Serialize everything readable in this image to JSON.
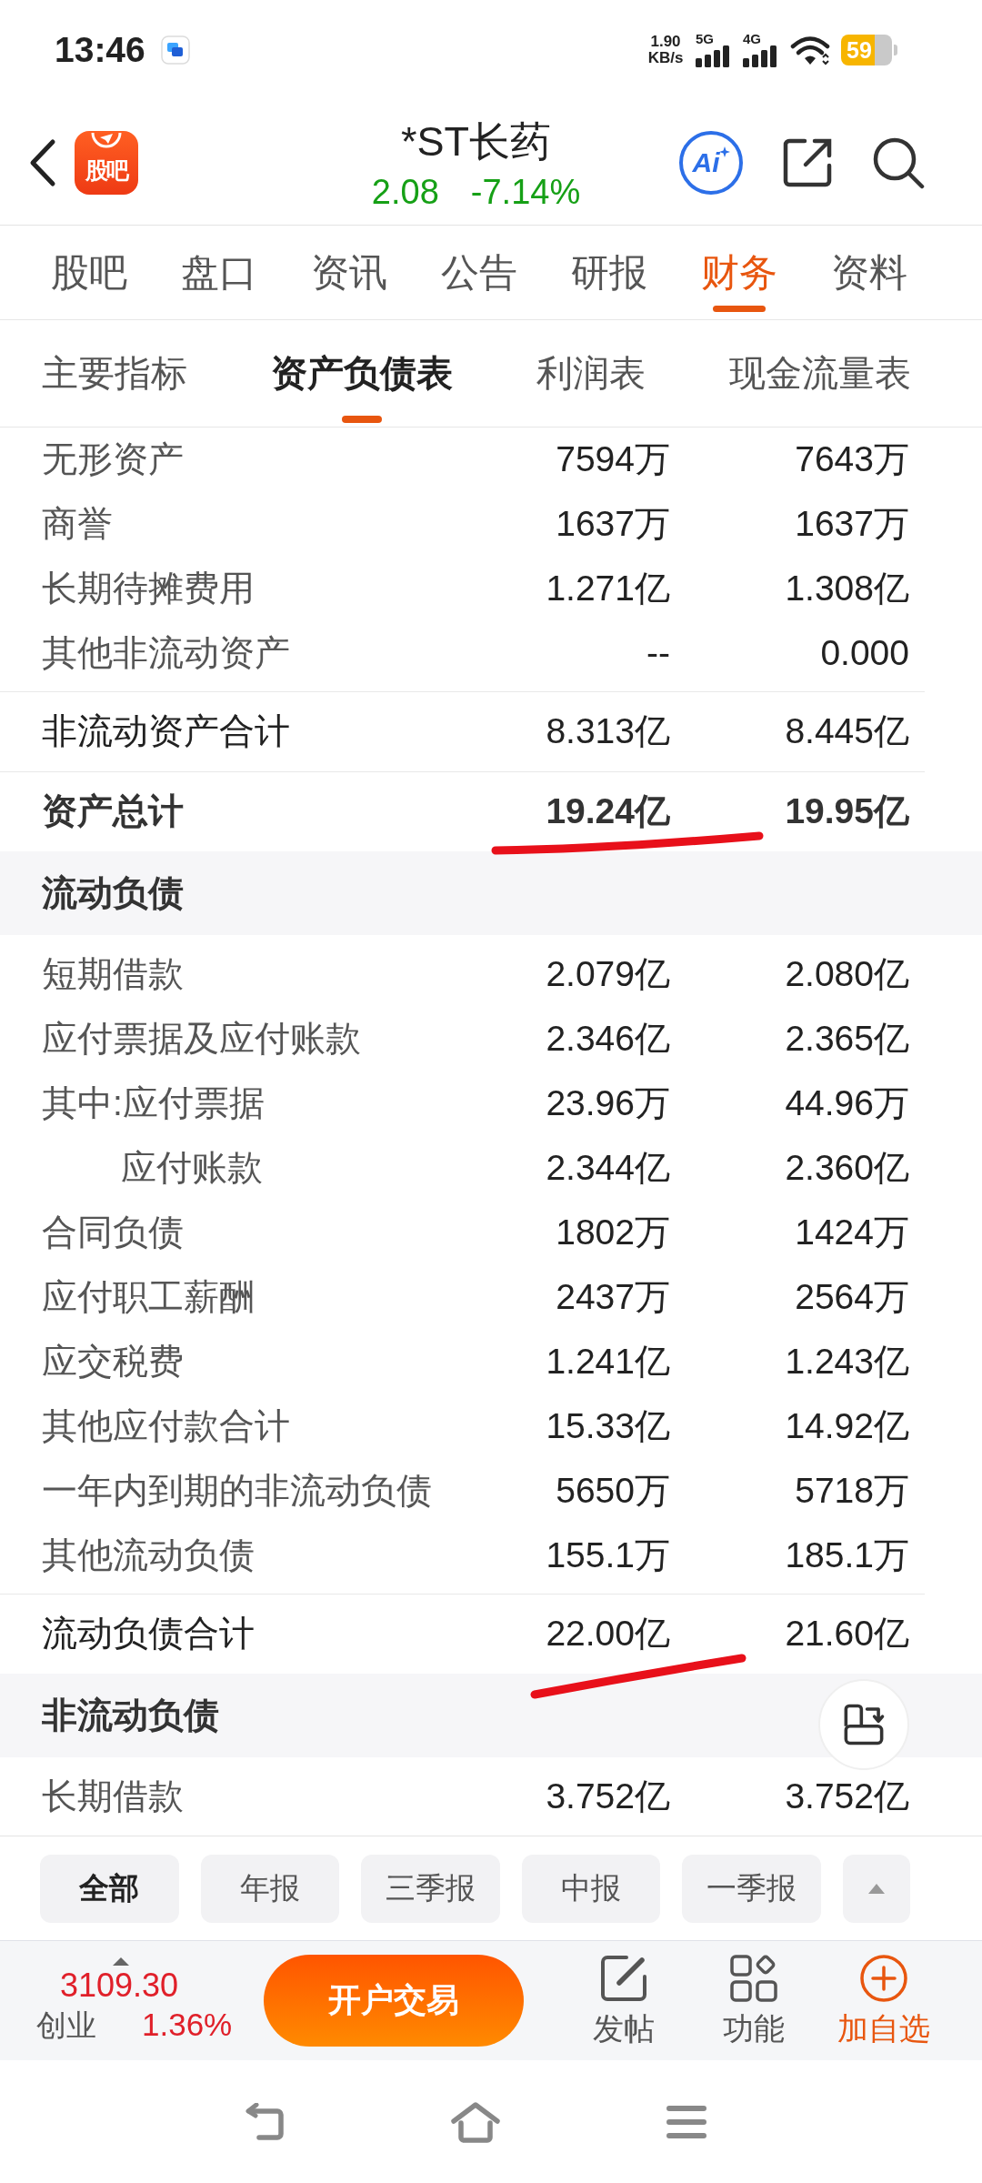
{
  "status_bar": {
    "time": "13:46",
    "net_speed": "1.90",
    "net_unit": "KB/s",
    "networks": [
      "5G",
      "4G"
    ],
    "battery": "59"
  },
  "header": {
    "logo_text": "股吧",
    "title": "*ST长药",
    "price": "2.08",
    "change": "-7.14%",
    "ai_label": "Ai"
  },
  "tabs": [
    {
      "label": "股吧",
      "selected": false
    },
    {
      "label": "盘口",
      "selected": false
    },
    {
      "label": "资讯",
      "selected": false
    },
    {
      "label": "公告",
      "selected": false
    },
    {
      "label": "研报",
      "selected": false
    },
    {
      "label": "财务",
      "selected": true
    },
    {
      "label": "资料",
      "selected": false
    }
  ],
  "subtabs": [
    {
      "label": "主要指标",
      "selected": false
    },
    {
      "label": "资产负债表",
      "selected": true
    },
    {
      "label": "利润表",
      "selected": false
    },
    {
      "label": "现金流量表",
      "selected": false
    }
  ],
  "rows": [
    {
      "kind": "item",
      "label": "无形资产",
      "values": [
        "7594万",
        "7643万"
      ],
      "marked": false
    },
    {
      "kind": "item",
      "label": "商誉",
      "values": [
        "1637万",
        "1637万"
      ],
      "marked": false
    },
    {
      "kind": "item",
      "label": "长期待摊费用",
      "values": [
        "1.271亿",
        "1.308亿"
      ],
      "marked": false
    },
    {
      "kind": "item",
      "label": "其他非流动资产",
      "values": [
        "--",
        "0.000"
      ],
      "marked": false
    },
    {
      "kind": "subtotal",
      "label": "非流动资产合计",
      "values": [
        "8.313亿",
        "8.445亿"
      ],
      "marked": false
    },
    {
      "kind": "total",
      "label": "资产总计",
      "values": [
        "19.24亿",
        "19.95亿"
      ],
      "marked": true
    },
    {
      "kind": "section",
      "label": "流动负债",
      "marked": false
    },
    {
      "kind": "item",
      "label": "短期借款",
      "values": [
        "2.079亿",
        "2.080亿"
      ],
      "marked": false
    },
    {
      "kind": "item",
      "label": "应付票据及应付账款",
      "values": [
        "2.346亿",
        "2.365亿"
      ],
      "marked": false
    },
    {
      "kind": "item",
      "label": "其中:应付票据",
      "values": [
        "23.96万",
        "44.96万"
      ],
      "marked": false
    },
    {
      "kind": "indented",
      "label": "应付账款",
      "values": [
        "2.344亿",
        "2.360亿"
      ],
      "marked": false
    },
    {
      "kind": "item",
      "label": "合同负债",
      "values": [
        "1802万",
        "1424万"
      ],
      "marked": false
    },
    {
      "kind": "item",
      "label": "应付职工薪酬",
      "values": [
        "2437万",
        "2564万"
      ],
      "marked": false
    },
    {
      "kind": "item",
      "label": "应交税费",
      "values": [
        "1.241亿",
        "1.243亿"
      ],
      "marked": false
    },
    {
      "kind": "item",
      "label": "其他应付款合计",
      "values": [
        "15.33亿",
        "14.92亿"
      ],
      "marked": false
    },
    {
      "kind": "item",
      "label": "一年内到期的非流动负债",
      "values": [
        "5650万",
        "5718万"
      ],
      "marked": false
    },
    {
      "kind": "item",
      "label": "其他流动负债",
      "values": [
        "155.1万",
        "185.1万"
      ],
      "marked": false
    },
    {
      "kind": "subtotal",
      "label": "流动负债合计",
      "values": [
        "22.00亿",
        "21.60亿"
      ],
      "marked": true
    },
    {
      "kind": "section",
      "label": "非流动负债",
      "marked": false
    },
    {
      "kind": "item",
      "label": "长期借款",
      "values": [
        "3.752亿",
        "3.752亿"
      ],
      "marked": false
    }
  ],
  "period_filters": [
    {
      "label": "全部",
      "selected": true
    },
    {
      "label": "年报",
      "selected": false
    },
    {
      "label": "三季报",
      "selected": false
    },
    {
      "label": "中报",
      "selected": false
    },
    {
      "label": "一季报",
      "selected": false
    }
  ],
  "index_quote": {
    "value": "3109.30",
    "name": "创业",
    "change": "1.36%"
  },
  "trade_button": "开户交易",
  "tools": [
    {
      "kind": "post",
      "label": "发帖"
    },
    {
      "kind": "apps",
      "label": "功能"
    },
    {
      "kind": "add",
      "label": "加自选"
    }
  ]
}
